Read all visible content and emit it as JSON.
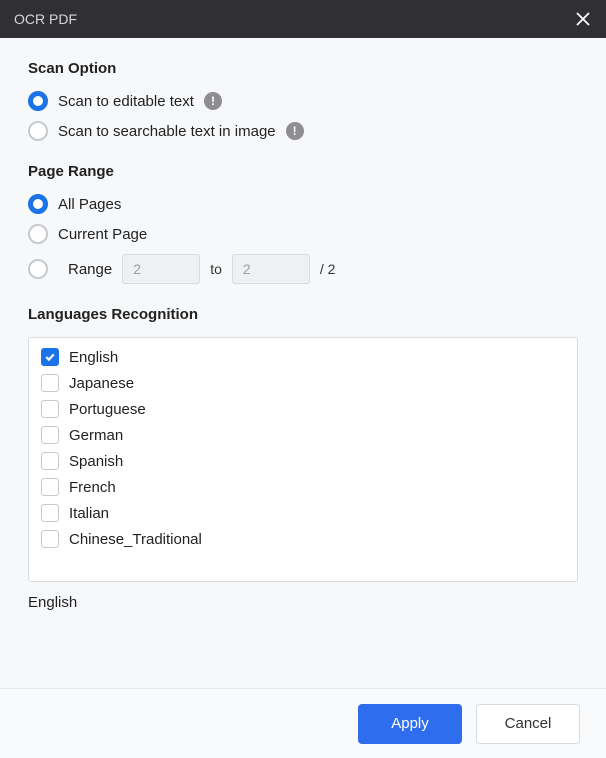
{
  "titlebar": {
    "title": "OCR PDF"
  },
  "scan": {
    "section_title": "Scan Option",
    "options": [
      {
        "label": "Scan to editable text",
        "selected": true,
        "has_info": true
      },
      {
        "label": "Scan to searchable text in image",
        "selected": false,
        "has_info": true
      }
    ]
  },
  "page_range": {
    "section_title": "Page Range",
    "all_label": "All Pages",
    "current_label": "Current Page",
    "range_label": "Range",
    "from_value": "2",
    "to_label": "to",
    "to_value": "2",
    "total_text": "/ 2",
    "selected": "all"
  },
  "languages": {
    "section_title": "Languages Recognition",
    "items": [
      {
        "label": "English",
        "checked": true
      },
      {
        "label": "Japanese",
        "checked": false
      },
      {
        "label": "Portuguese",
        "checked": false
      },
      {
        "label": "German",
        "checked": false
      },
      {
        "label": "Spanish",
        "checked": false
      },
      {
        "label": "French",
        "checked": false
      },
      {
        "label": "Italian",
        "checked": false
      },
      {
        "label": "Chinese_Traditional",
        "checked": false
      }
    ],
    "selected_summary": "English"
  },
  "footer": {
    "apply": "Apply",
    "cancel": "Cancel"
  }
}
